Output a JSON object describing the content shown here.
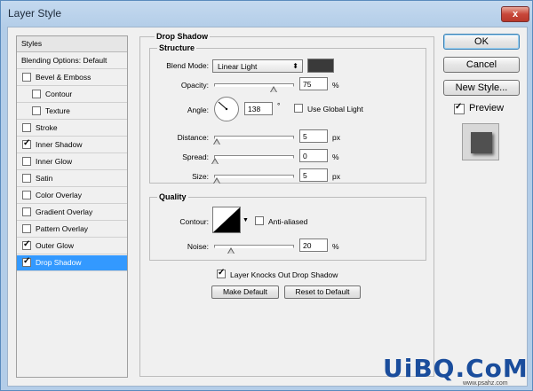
{
  "window": {
    "title": "Layer Style",
    "close": "x"
  },
  "styles_list": {
    "header": "Styles",
    "items": [
      {
        "label": "Blending Options: Default",
        "checkbox": false,
        "checked": false,
        "indent": false
      },
      {
        "label": "Bevel & Emboss",
        "checkbox": true,
        "checked": false,
        "indent": false
      },
      {
        "label": "Contour",
        "checkbox": true,
        "checked": false,
        "indent": true
      },
      {
        "label": "Texture",
        "checkbox": true,
        "checked": false,
        "indent": true
      },
      {
        "label": "Stroke",
        "checkbox": true,
        "checked": false,
        "indent": false
      },
      {
        "label": "Inner Shadow",
        "checkbox": true,
        "checked": true,
        "indent": false
      },
      {
        "label": "Inner Glow",
        "checkbox": true,
        "checked": false,
        "indent": false
      },
      {
        "label": "Satin",
        "checkbox": true,
        "checked": false,
        "indent": false
      },
      {
        "label": "Color Overlay",
        "checkbox": true,
        "checked": false,
        "indent": false
      },
      {
        "label": "Gradient Overlay",
        "checkbox": true,
        "checked": false,
        "indent": false
      },
      {
        "label": "Pattern Overlay",
        "checkbox": true,
        "checked": false,
        "indent": false
      },
      {
        "label": "Outer Glow",
        "checkbox": true,
        "checked": true,
        "indent": false
      },
      {
        "label": "Drop Shadow",
        "checkbox": true,
        "checked": true,
        "indent": false,
        "selected": true
      }
    ]
  },
  "drop_shadow": {
    "title": "Drop Shadow",
    "structure": {
      "title": "Structure",
      "blend_mode_label": "Blend Mode:",
      "blend_mode": "Linear Light",
      "color": "#3a3a3a",
      "opacity_label": "Opacity:",
      "opacity": "75",
      "opacity_unit": "%",
      "opacity_fraction": 0.75,
      "angle_label": "Angle:",
      "angle": "138",
      "angle_unit": "°",
      "use_global_light_label": "Use Global Light",
      "use_global_light": false,
      "distance_label": "Distance:",
      "distance": "5",
      "distance_unit": "px",
      "distance_fraction": 0.02,
      "spread_label": "Spread:",
      "spread": "0",
      "spread_unit": "%",
      "spread_fraction": 0.0,
      "size_label": "Size:",
      "size": "5",
      "size_unit": "px",
      "size_fraction": 0.02
    },
    "quality": {
      "title": "Quality",
      "contour_label": "Contour:",
      "anti_aliased_label": "Anti-aliased",
      "anti_aliased": false,
      "noise_label": "Noise:",
      "noise": "20",
      "noise_unit": "%",
      "noise_fraction": 0.2
    },
    "knocks_out_label": "Layer Knocks Out Drop Shadow",
    "knocks_out": true,
    "make_default": "Make Default",
    "reset_default": "Reset to Default"
  },
  "buttons": {
    "ok": "OK",
    "cancel": "Cancel",
    "new_style": "New Style...",
    "preview_label": "Preview",
    "preview_checked": true
  },
  "watermark": {
    "text": "UiBQ.CoM",
    "sub": "www.psahz.com"
  }
}
